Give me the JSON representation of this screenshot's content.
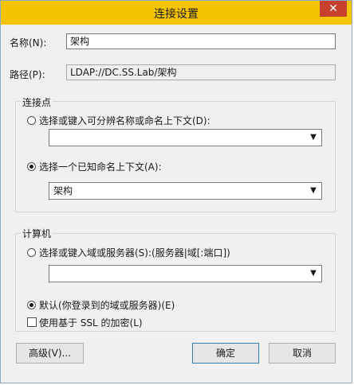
{
  "window": {
    "title": "连接设置",
    "close_label": "✕"
  },
  "fields": {
    "name_label": "名称(N):",
    "name_value": "架构",
    "path_label": "路径(P):",
    "path_value": "LDAP://DC.SS.Lab/架构"
  },
  "connection_point": {
    "title": "连接点",
    "option_custom_label": "选择或键入可分辨名称或命名上下文(D):",
    "option_custom_selected": false,
    "custom_value": "",
    "option_known_label": "选择一个已知命名上下文(A):",
    "option_known_selected": true,
    "known_value": "架构"
  },
  "computer": {
    "title": "计算机",
    "option_custom_label": "选择或键入域或服务器(S):(服务器|域[:端口])",
    "option_custom_selected": false,
    "custom_value": "",
    "option_default_label": "默认(你登录到的域或服务器)(E)",
    "option_default_selected": true,
    "ssl_label": "使用基于 SSL 的加密(L)",
    "ssl_checked": false
  },
  "buttons": {
    "advanced": "高级(V)...",
    "ok": "确定",
    "cancel": "取消"
  },
  "icons": {
    "dropdown": "chevron-down-icon",
    "close": "close-icon"
  }
}
